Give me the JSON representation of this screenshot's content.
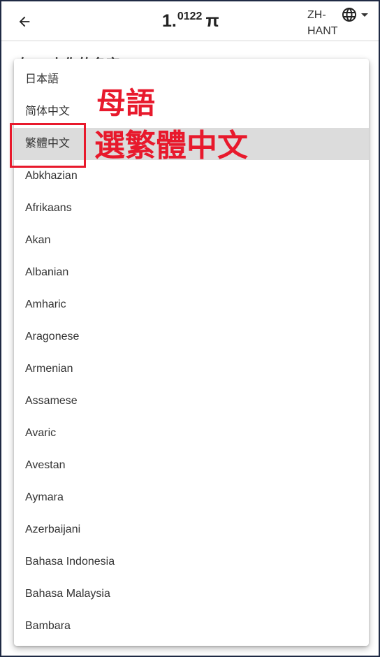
{
  "appbar": {
    "title_base": "1.",
    "title_sup": "0122",
    "title_symbol": "π",
    "lang_code": "ZH-HANT",
    "back_icon": "arrow-left-icon",
    "globe_icon": "globe-icon"
  },
  "behind": {
    "label": "在 ... 上你的名字"
  },
  "menu": {
    "items": [
      "日本語",
      "简体中文",
      "繁體中文",
      "Abkhazian",
      "Afrikaans",
      "Akan",
      "Albanian",
      "Amharic",
      "Aragonese",
      "Armenian",
      "Assamese",
      "Avaric",
      "Avestan",
      "Aymara",
      "Azerbaijani",
      "Bahasa Indonesia",
      "Bahasa Malaysia",
      "Bambara"
    ],
    "selected_index": 2
  },
  "annotations": {
    "line1": "母語",
    "line2": "選繁體中文",
    "color": "#e8192c"
  }
}
